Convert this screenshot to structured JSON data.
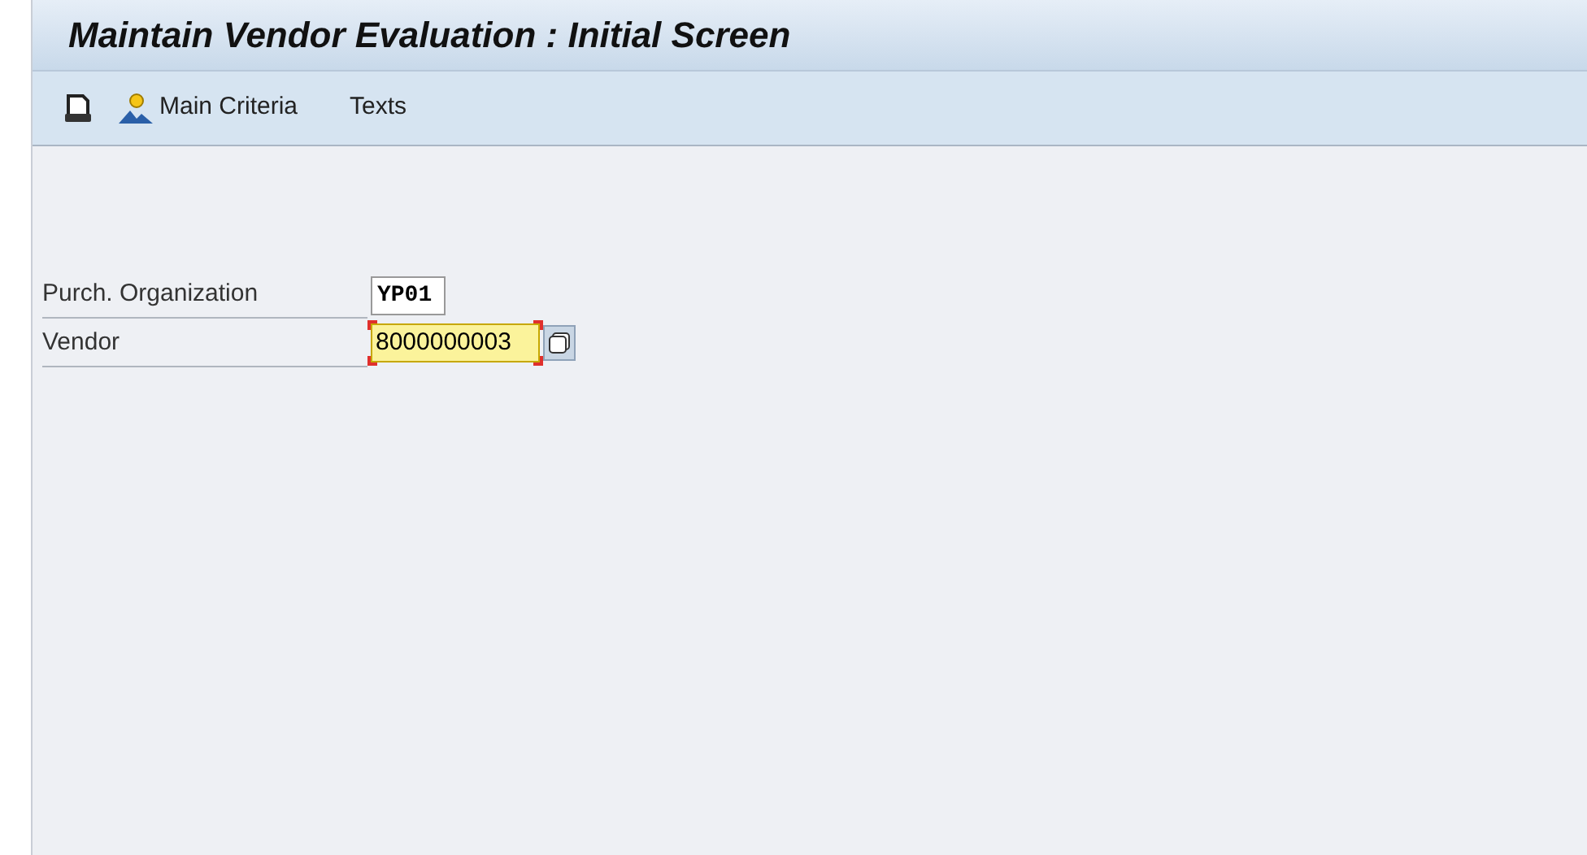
{
  "window": {
    "title": "Maintain Vendor Evaluation : Initial Screen"
  },
  "toolbar": [
    {
      "kind": "print"
    },
    {
      "kind": "criteria",
      "label": "Main Criteria"
    },
    {
      "kind": "text",
      "label": "Texts"
    }
  ],
  "fields": [
    {
      "label": "Purch. Organization",
      "value": "YP01",
      "focused": false,
      "value_help": false
    },
    {
      "label": "Vendor",
      "value": "8000000003",
      "focused": true,
      "value_help": true
    }
  ]
}
